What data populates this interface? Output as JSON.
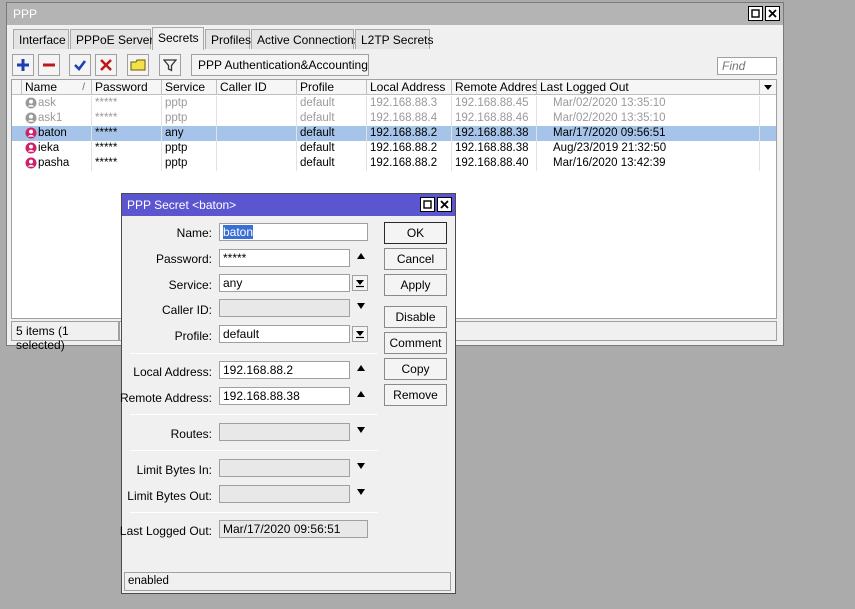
{
  "window": {
    "title": "PPP",
    "restore_icon": "restore-icon",
    "close_icon": "close-icon"
  },
  "tabs": [
    {
      "label": "Interface"
    },
    {
      "label": "PPPoE Servers"
    },
    {
      "label": "Secrets",
      "active": true
    },
    {
      "label": "Profiles"
    },
    {
      "label": "Active Connections"
    },
    {
      "label": "L2TP Secrets"
    }
  ],
  "toolbar": {
    "add_icon": "plus-icon",
    "remove_icon": "minus-icon",
    "enable_icon": "check-icon",
    "disable_icon": "x-icon",
    "comment_icon": "note-icon",
    "filter_icon": "filter-icon",
    "auth_button": "PPP Authentication&Accounting",
    "find_placeholder": "Find"
  },
  "table": {
    "columns": [
      "Name",
      "Password",
      "Service",
      "Caller ID",
      "Profile",
      "Local Address",
      "Remote Address",
      "Last Logged Out"
    ],
    "sort_marker": "/",
    "rows": [
      {
        "name": "ask",
        "password": "*****",
        "service": "pptp",
        "caller_id": "",
        "profile": "default",
        "local": "192.168.88.3",
        "remote": "192.168.88.45",
        "last": "Mar/02/2020 13:35:10",
        "state": "disabled"
      },
      {
        "name": "ask1",
        "password": "*****",
        "service": "pptp",
        "caller_id": "",
        "profile": "default",
        "local": "192.168.88.4",
        "remote": "192.168.88.46",
        "last": "Mar/02/2020 13:35:10",
        "state": "disabled"
      },
      {
        "name": "baton",
        "password": "*****",
        "service": "any",
        "caller_id": "",
        "profile": "default",
        "local": "192.168.88.2",
        "remote": "192.168.88.38",
        "last": "Mar/17/2020 09:56:51",
        "state": "selected"
      },
      {
        "name": "ieka",
        "password": "*****",
        "service": "pptp",
        "caller_id": "",
        "profile": "default",
        "local": "192.168.88.2",
        "remote": "192.168.88.38",
        "last": "Aug/23/2019 21:32:50",
        "state": "normal"
      },
      {
        "name": "pasha",
        "password": "*****",
        "service": "pptp",
        "caller_id": "",
        "profile": "default",
        "local": "192.168.88.2",
        "remote": "192.168.88.40",
        "last": "Mar/16/2020 13:42:39",
        "state": "normal"
      }
    ],
    "status": "5 items (1 selected)"
  },
  "dialog": {
    "title": "PPP Secret <baton>",
    "labels": {
      "name": "Name:",
      "password": "Password:",
      "service": "Service:",
      "caller_id": "Caller ID:",
      "profile": "Profile:",
      "local_address": "Local Address:",
      "remote_address": "Remote Address:",
      "routes": "Routes:",
      "limit_in": "Limit Bytes In:",
      "limit_out": "Limit Bytes Out:",
      "last_logged_out": "Last Logged Out:"
    },
    "values": {
      "name": "baton",
      "password": "*****",
      "service": "any",
      "caller_id": "",
      "profile": "default",
      "local_address": "192.168.88.2",
      "remote_address": "192.168.88.38",
      "routes": "",
      "limit_in": "",
      "limit_out": "",
      "last_logged_out": "Mar/17/2020 09:56:51"
    },
    "buttons": {
      "ok": "OK",
      "cancel": "Cancel",
      "apply": "Apply",
      "disable": "Disable",
      "comment": "Comment",
      "copy": "Copy",
      "remove": "Remove"
    },
    "status": "enabled"
  },
  "colors": {
    "selected_row": "#a6c4ea",
    "dialog_title": "#5b55d0",
    "user_icon_active": "#d0206a",
    "user_icon_disabled": "#9a9a9a"
  }
}
